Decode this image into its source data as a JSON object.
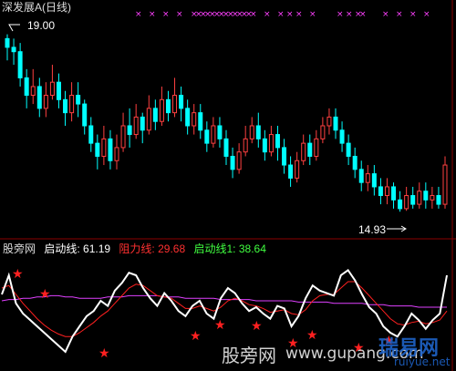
{
  "chart_title": "深发展A(日线)",
  "price_high_label": "19.00",
  "price_low_label": "14.93",
  "indicator": {
    "name": "股旁网",
    "launch_label": "启动线:",
    "launch_value": "61.19",
    "resist_label": "阻力线:",
    "resist_value": "29.68",
    "launch1_label": "启动线1:",
    "launch1_value": "38.64"
  },
  "watermarks": {
    "cn": "股旁网",
    "domain": "www.gupang.com",
    "right_cn": "瑞易网",
    "right_domain": "ruiyue.net"
  },
  "colors": {
    "bg": "#000000",
    "up": "#ff4040",
    "down": "#00ffff",
    "white": "#ffffff",
    "red_line": "#ff2020",
    "purple_line": "#e040ff",
    "star": "#ff2020",
    "x_marker": "#ff40ff",
    "launch_text": "#ffffff",
    "resist_text": "#ff3030",
    "launch1_text": "#40ff40"
  },
  "chart_data": {
    "type": "candlestick",
    "price_range": [
      14.93,
      19.0
    ],
    "candles": [
      [
        18.9,
        18.7,
        19.0,
        18.4
      ],
      [
        18.7,
        18.6,
        18.9,
        18.3
      ],
      [
        18.6,
        18.0,
        18.8,
        17.8
      ],
      [
        18.0,
        17.6,
        18.2,
        17.3
      ],
      [
        17.6,
        17.8,
        18.2,
        17.4
      ],
      [
        17.8,
        17.3,
        18.0,
        17.1
      ],
      [
        17.3,
        17.6,
        17.9,
        17.1
      ],
      [
        17.6,
        17.9,
        18.3,
        17.5
      ],
      [
        17.9,
        17.5,
        18.1,
        17.3
      ],
      [
        17.5,
        17.2,
        17.7,
        16.9
      ],
      [
        17.2,
        17.6,
        17.9,
        17.0
      ],
      [
        17.6,
        17.4,
        17.9,
        17.1
      ],
      [
        17.4,
        16.9,
        17.5,
        16.7
      ],
      [
        16.9,
        16.5,
        17.1,
        16.3
      ],
      [
        16.5,
        16.2,
        16.7,
        15.9
      ],
      [
        16.2,
        16.6,
        16.9,
        16.0
      ],
      [
        16.6,
        16.1,
        16.8,
        15.9
      ],
      [
        16.1,
        16.4,
        16.7,
        15.9
      ],
      [
        16.4,
        16.9,
        17.2,
        16.3
      ],
      [
        16.9,
        16.7,
        17.3,
        16.4
      ],
      [
        16.7,
        17.1,
        17.4,
        16.6
      ],
      [
        17.1,
        16.8,
        17.2,
        16.5
      ],
      [
        16.8,
        17.3,
        17.6,
        16.7
      ],
      [
        17.3,
        17.0,
        17.5,
        16.8
      ],
      [
        17.0,
        17.5,
        17.8,
        16.9
      ],
      [
        17.5,
        17.2,
        17.7,
        17.0
      ],
      [
        17.2,
        17.6,
        18.0,
        17.1
      ],
      [
        17.6,
        17.3,
        17.8,
        17.0
      ],
      [
        17.3,
        16.9,
        17.5,
        16.7
      ],
      [
        16.9,
        17.2,
        17.4,
        16.7
      ],
      [
        17.2,
        16.8,
        17.4,
        16.6
      ],
      [
        16.8,
        16.5,
        17.0,
        16.3
      ],
      [
        16.5,
        16.9,
        17.1,
        16.4
      ],
      [
        16.9,
        16.6,
        17.1,
        16.4
      ],
      [
        16.6,
        16.2,
        16.8,
        16.0
      ],
      [
        16.2,
        15.9,
        16.4,
        15.7
      ],
      [
        15.9,
        16.3,
        16.5,
        15.8
      ],
      [
        16.3,
        16.6,
        16.9,
        16.2
      ],
      [
        16.6,
        16.9,
        17.1,
        16.5
      ],
      [
        16.9,
        16.6,
        17.2,
        16.4
      ],
      [
        16.6,
        16.3,
        16.8,
        16.1
      ],
      [
        16.3,
        16.7,
        16.9,
        16.2
      ],
      [
        16.7,
        16.4,
        16.9,
        16.1
      ],
      [
        16.4,
        16.0,
        16.6,
        15.8
      ],
      [
        16.0,
        15.7,
        16.2,
        15.5
      ],
      [
        15.7,
        16.1,
        16.3,
        15.6
      ],
      [
        16.1,
        16.5,
        16.7,
        16.0
      ],
      [
        16.5,
        16.2,
        16.7,
        16.0
      ],
      [
        16.2,
        16.6,
        16.8,
        16.1
      ],
      [
        16.6,
        16.9,
        17.1,
        16.5
      ],
      [
        16.9,
        17.1,
        17.3,
        16.7
      ],
      [
        17.1,
        16.8,
        17.3,
        16.6
      ],
      [
        16.8,
        16.5,
        17.0,
        16.3
      ],
      [
        16.5,
        16.2,
        16.7,
        16.0
      ],
      [
        16.2,
        15.9,
        16.4,
        15.7
      ],
      [
        15.9,
        15.6,
        16.1,
        15.4
      ],
      [
        15.6,
        15.8,
        16.0,
        15.4
      ],
      [
        15.8,
        15.5,
        16.0,
        15.3
      ],
      [
        15.5,
        15.3,
        15.7,
        15.1
      ],
      [
        15.3,
        15.5,
        15.7,
        15.1
      ],
      [
        15.5,
        15.2,
        15.6,
        15.0
      ],
      [
        15.2,
        15.0,
        15.4,
        14.93
      ],
      [
        15.0,
        15.3,
        15.5,
        14.95
      ],
      [
        15.3,
        15.1,
        15.5,
        15.0
      ],
      [
        15.1,
        15.4,
        15.6,
        15.0
      ],
      [
        15.4,
        15.2,
        15.6,
        15.0
      ],
      [
        15.2,
        15.3,
        15.5,
        15.0
      ],
      [
        15.3,
        15.1,
        15.5,
        15.0
      ],
      [
        15.1,
        16.0,
        16.2,
        15.0
      ]
    ],
    "indicator_white": [
      55,
      70,
      48,
      40,
      35,
      30,
      25,
      20,
      15,
      10,
      22,
      30,
      38,
      42,
      50,
      46,
      58,
      64,
      72,
      70,
      60,
      52,
      46,
      56,
      50,
      42,
      38,
      46,
      50,
      40,
      36,
      52,
      60,
      56,
      48,
      42,
      45,
      40,
      36,
      46,
      44,
      30,
      38,
      52,
      62,
      58,
      56,
      54,
      70,
      74,
      66,
      55,
      45,
      40,
      30,
      25,
      22,
      30,
      40,
      35,
      28,
      35,
      40,
      70
    ],
    "indicator_red": [
      60,
      62,
      55,
      48,
      42,
      36,
      31,
      27,
      24,
      22,
      22,
      25,
      29,
      33,
      38,
      42,
      48,
      54,
      60,
      63,
      62,
      58,
      54,
      53,
      52,
      48,
      44,
      44,
      46,
      44,
      42,
      45,
      50,
      52,
      50,
      47,
      46,
      44,
      41,
      42,
      43,
      40,
      39,
      43,
      50,
      54,
      55,
      55,
      60,
      65,
      65,
      60,
      54,
      48,
      42,
      36,
      32,
      31,
      33,
      34,
      32,
      33,
      35,
      42
    ],
    "indicator_purple": [
      50,
      51,
      51,
      52,
      52,
      53,
      53,
      54,
      54,
      53,
      53,
      52,
      52,
      52,
      52,
      53,
      53,
      53,
      54,
      54,
      54,
      54,
      54,
      53,
      53,
      53,
      52,
      52,
      52,
      52,
      52,
      51,
      51,
      51,
      51,
      51,
      50,
      50,
      50,
      50,
      50,
      50,
      49,
      49,
      49,
      49,
      49,
      48,
      48,
      48,
      48,
      48,
      47,
      47,
      47,
      46,
      46,
      46,
      46,
      45,
      45,
      45,
      45,
      45
    ]
  }
}
